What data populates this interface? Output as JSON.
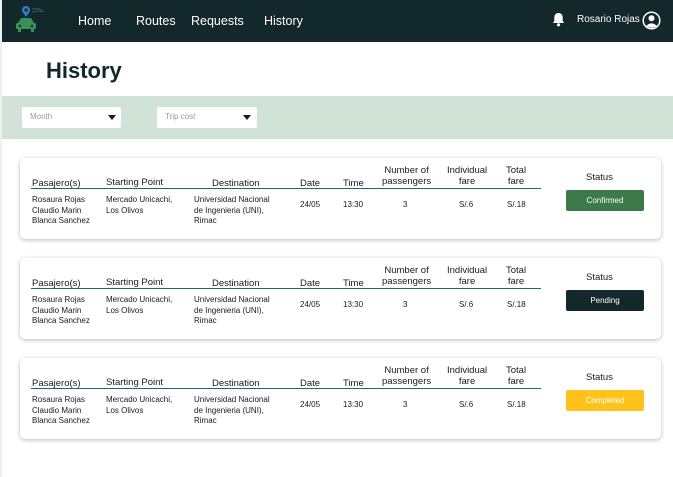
{
  "nav": {
    "logo_icon": "car-pin-logo",
    "links": [
      {
        "label": "Home"
      },
      {
        "label": "Routes"
      },
      {
        "label": "Requests"
      },
      {
        "label": "History"
      }
    ],
    "bell_icon": "bell-icon",
    "user_name": "Rosario Rojas",
    "user_icon": "user-circle-icon"
  },
  "page": {
    "title": "History"
  },
  "filters": {
    "month_placeholder": "Month",
    "trip_cost_placeholder": "Trip cost"
  },
  "table_headers": {
    "passengers": "Pasajero(s)",
    "starting_point": "Starting Point",
    "destination": "Destination",
    "date": "Date",
    "time": "Time",
    "number_of_passengers": [
      "Number of",
      "passengers"
    ],
    "individual_fare": [
      "Individual",
      "fare"
    ],
    "total_fare": [
      "Total",
      "fare"
    ],
    "status": "Status"
  },
  "trips": [
    {
      "passengers": [
        "Rosaura Rojas",
        "Claudio Marin",
        "Blanca Sanchez"
      ],
      "starting_point": [
        "Mercado Unicachi,",
        "Los Olivos"
      ],
      "destination": [
        "Universidad Nacional",
        "de Ingenieria (UNI),",
        "Rimac"
      ],
      "date": "24/05",
      "time": "13:30",
      "num_passengers": "3",
      "individual_fare": "S/.6",
      "total_fare": "S/.18",
      "status": "Confirmed"
    },
    {
      "passengers": [
        "Rosaura Rojas",
        "Claudio Marin",
        "Blanca Sanchez"
      ],
      "starting_point": [
        "Mercado Unicachi,",
        "Los Olivos"
      ],
      "destination": [
        "Universidad Nacional",
        "de Ingenieria (UNI),",
        "Rimac"
      ],
      "date": "24/05",
      "time": "13:30",
      "num_passengers": "3",
      "individual_fare": "S/.6",
      "total_fare": "S/.18",
      "status": "Pending"
    },
    {
      "passengers": [
        "Rosaura Rojas",
        "Claudio Marin",
        "Blanca Sanchez"
      ],
      "starting_point": [
        "Mercado Unicachi,",
        "Los Olivos"
      ],
      "destination": [
        "Universidad Nacional",
        "de Ingenieria (UNI),",
        "Rimac"
      ],
      "date": "24/05",
      "time": "13:30",
      "num_passengers": "3",
      "individual_fare": "S/.6",
      "total_fare": "S/.18",
      "status": "Completed"
    }
  ],
  "colors": {
    "nav_background": "#13282b",
    "filter_band": "#d1e3d6",
    "status_confirmed": "#3c7a4a",
    "status_pending": "#13282b",
    "status_completed": "#ffc21a"
  }
}
